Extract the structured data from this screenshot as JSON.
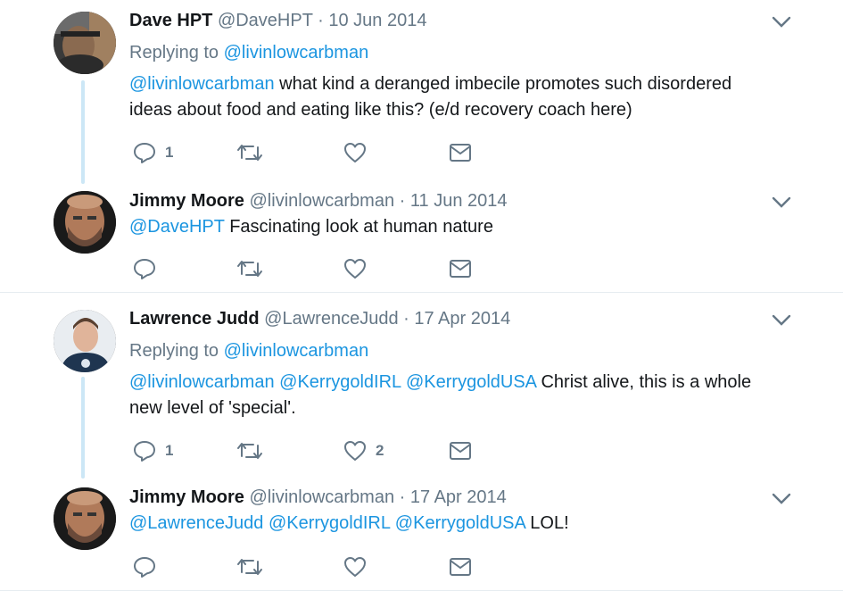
{
  "tweets": [
    {
      "name": "Dave HPT",
      "handle": "@DaveHPT",
      "date": "10 Jun 2014",
      "replying_label": "Replying to",
      "replying_to": "@livinlowcarbman",
      "mentions": [
        "@livinlowcarbman"
      ],
      "text_line1": "what kind a deranged imbecile promotes such disordered",
      "text_line2": "ideas about food and eating like this? (e/d recovery coach here)",
      "reply_count": "1",
      "retweet_count": "",
      "like_count": ""
    },
    {
      "name": "Jimmy Moore",
      "handle": "@livinlowcarbman",
      "date": "11 Jun 2014",
      "mentions": [
        "@DaveHPT"
      ],
      "text_line1": "Fascinating look at human nature",
      "reply_count": "",
      "retweet_count": "",
      "like_count": ""
    },
    {
      "name": "Lawrence Judd",
      "handle": "@LawrenceJudd",
      "date": "17 Apr 2014",
      "replying_label": "Replying to",
      "replying_to": "@livinlowcarbman",
      "mentions": [
        "@livinlowcarbman",
        "@KerrygoldIRL",
        "@KerrygoldUSA"
      ],
      "text_line1": "Christ alive, this is a whole",
      "text_line2": "new level of 'special'.",
      "reply_count": "1",
      "retweet_count": "",
      "like_count": "2"
    },
    {
      "name": "Jimmy Moore",
      "handle": "@livinlowcarbman",
      "date": "17 Apr 2014",
      "mentions": [
        "@LawrenceJudd",
        "@KerrygoldIRL",
        "@KerrygoldUSA"
      ],
      "text_line1": "LOL!",
      "reply_count": "",
      "retweet_count": "",
      "like_count": ""
    }
  ],
  "separator": "·",
  "colors": {
    "link": "#1b95e0",
    "muted": "#657786",
    "text": "#14171a",
    "thread_line": "#cce7f6",
    "divider": "#e6ecf0"
  },
  "icons": {
    "reply": "reply-icon",
    "retweet": "retweet-icon",
    "like": "heart-icon",
    "dm": "envelope-icon",
    "more": "chevron-down-icon"
  }
}
